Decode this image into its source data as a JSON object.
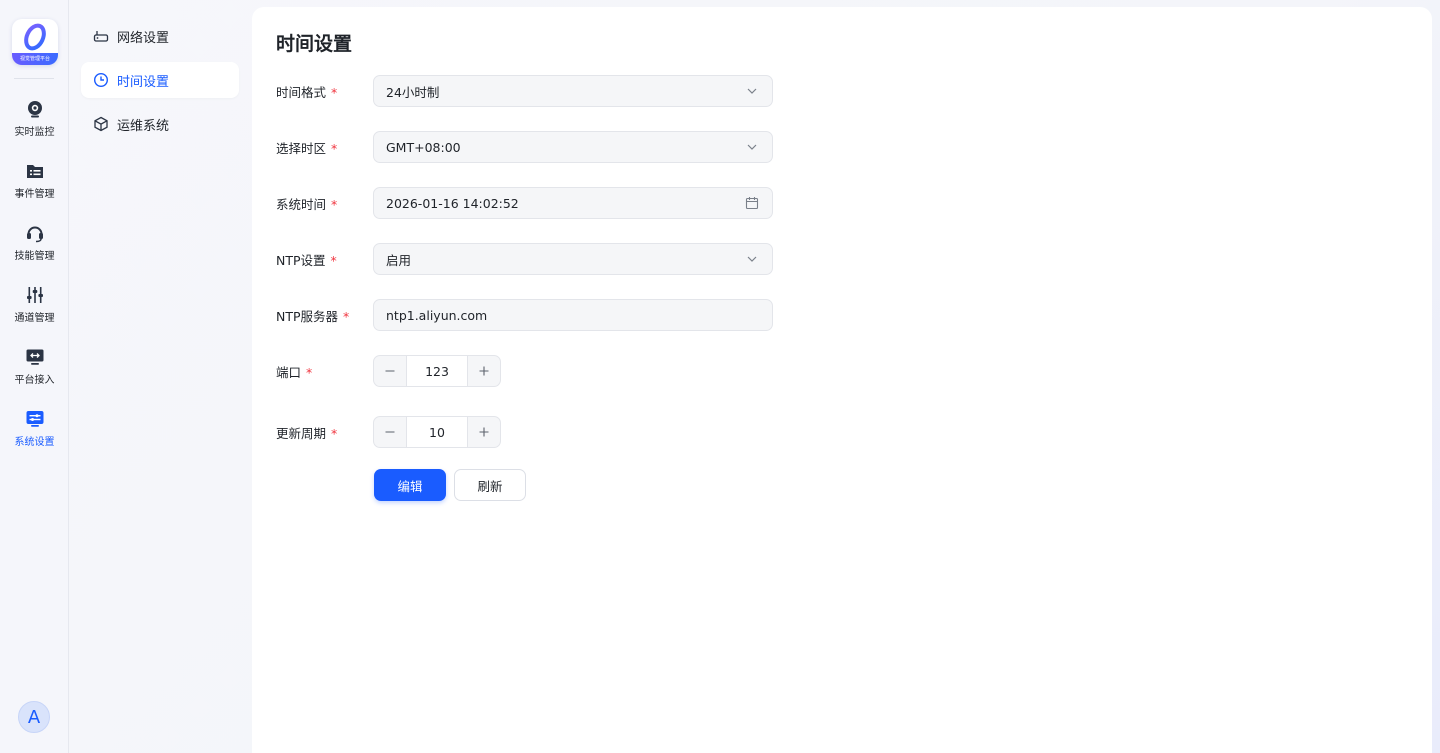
{
  "app": {
    "logo_text": "视觉管理平台"
  },
  "rail": {
    "items": [
      {
        "label": "实时监控",
        "icon": "camera-icon"
      },
      {
        "label": "事件管理",
        "icon": "folder-list-icon"
      },
      {
        "label": "技能管理",
        "icon": "headset-icon"
      },
      {
        "label": "通道管理",
        "icon": "sliders-icon"
      },
      {
        "label": "平台接入",
        "icon": "monitor-arrows-icon"
      },
      {
        "label": "系统设置",
        "icon": "settings-panel-icon"
      }
    ],
    "active_index": 5,
    "avatar_letter": "A"
  },
  "submenu": {
    "items": [
      {
        "label": "网络设置",
        "icon": "router-icon"
      },
      {
        "label": "时间设置",
        "icon": "clock-icon"
      },
      {
        "label": "运维系统",
        "icon": "cube-icon"
      }
    ],
    "active_index": 1
  },
  "page": {
    "title": "时间设置"
  },
  "form": {
    "time_format": {
      "label": "时间格式",
      "value": "24小时制"
    },
    "timezone": {
      "label": "选择时区",
      "value": "GMT+08:00"
    },
    "system_time": {
      "label": "系统时间",
      "value": "2026-01-16 14:02:52"
    },
    "ntp_setting": {
      "label": "NTP设置",
      "value": "启用"
    },
    "ntp_server": {
      "label": "NTP服务器",
      "value": "ntp1.aliyun.com"
    },
    "port": {
      "label": "端口",
      "value": "123"
    },
    "update_period": {
      "label": "更新周期",
      "value": "10"
    },
    "required_mark": "*"
  },
  "actions": {
    "edit_label": "编辑",
    "refresh_label": "刷新"
  },
  "colors": {
    "accent": "#1a5cff",
    "required": "#f0353f"
  }
}
